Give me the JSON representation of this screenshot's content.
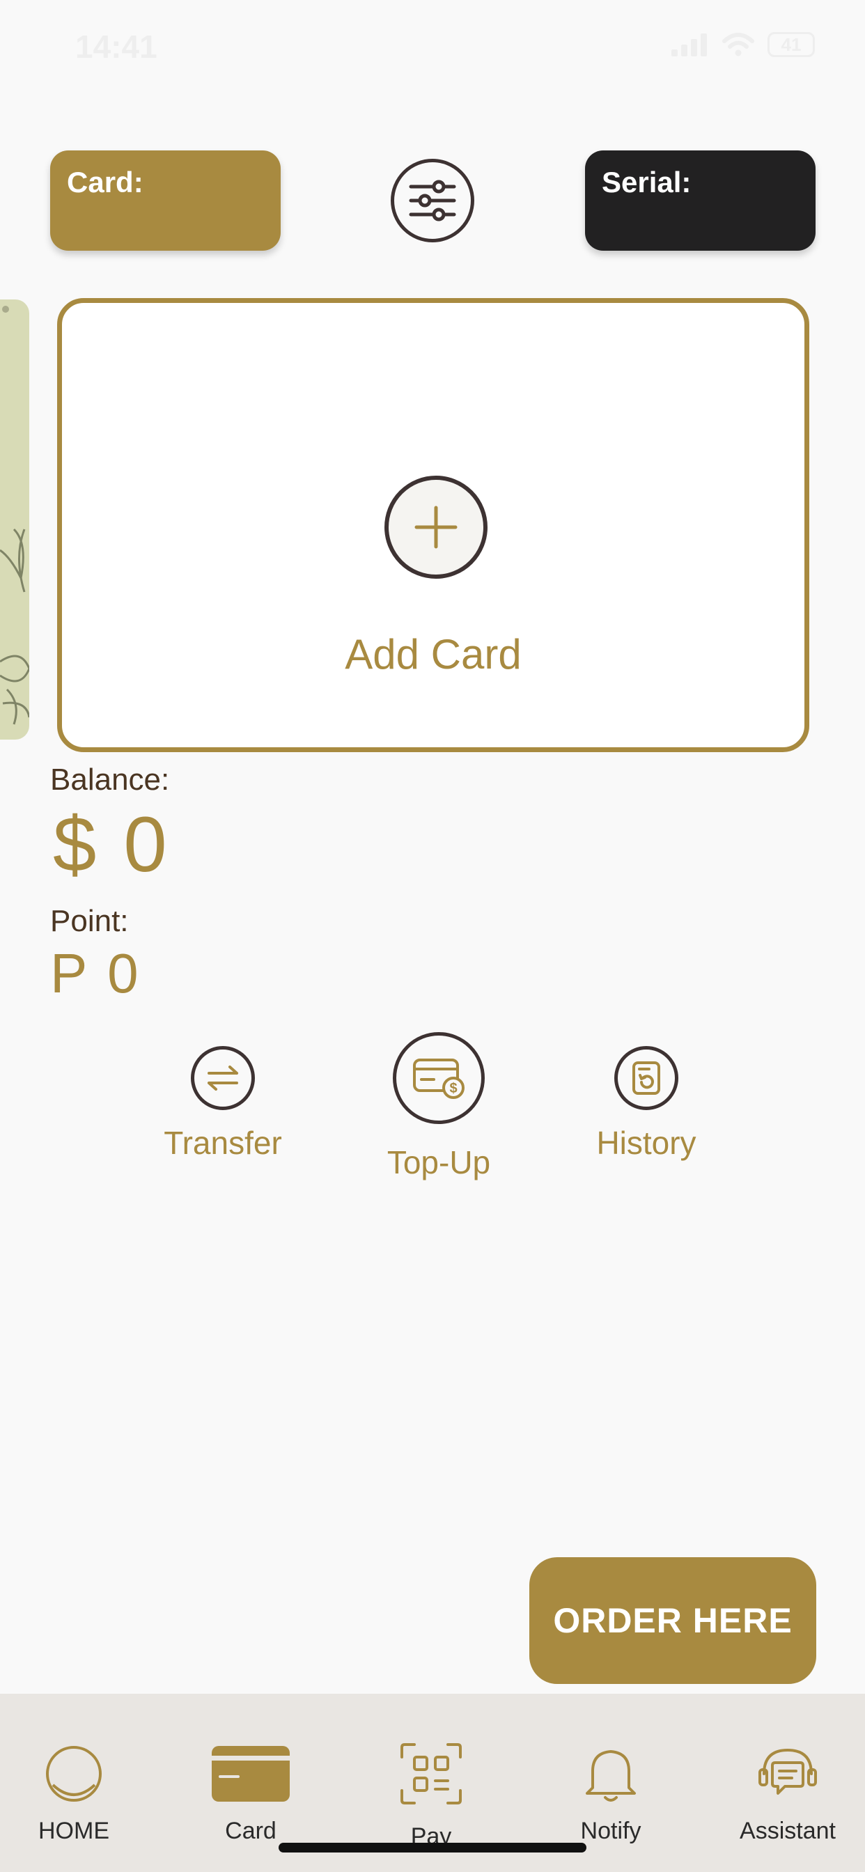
{
  "status_bar": {
    "time": "14:41",
    "battery": "41"
  },
  "chips": {
    "card_label": "Card:",
    "serial_label": "Serial:"
  },
  "add_card": {
    "label": "Add Card"
  },
  "balance": {
    "label": "Balance:",
    "value": "$ 0"
  },
  "point": {
    "label": "Point:",
    "value": "P 0"
  },
  "actions": [
    {
      "label": "Transfer",
      "icon": "transfer-arrows-icon"
    },
    {
      "label": "Top-Up",
      "icon": "card-dollar-icon"
    },
    {
      "label": "History",
      "icon": "history-receipt-icon"
    }
  ],
  "order_button": {
    "label": "ORDER HERE"
  },
  "tabs": [
    {
      "label": "HOME",
      "icon": "home-circle-icon"
    },
    {
      "label": "Card",
      "icon": "card-icon",
      "active": true
    },
    {
      "label": "Pay",
      "icon": "qr-scan-icon"
    },
    {
      "label": "Notify",
      "icon": "bell-icon"
    },
    {
      "label": "Assistant",
      "icon": "headset-chat-icon"
    }
  ],
  "colors": {
    "accent": "#a88a40",
    "dark": "#222122",
    "background": "#f9f9f9",
    "tab_bar": "#e9e6e2"
  }
}
